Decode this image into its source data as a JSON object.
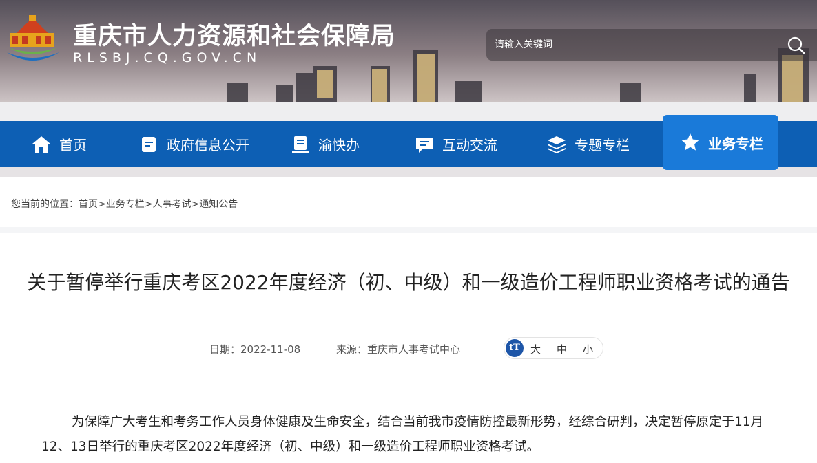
{
  "header": {
    "site_title": "重庆市人力资源和社会保障局",
    "site_domain": "RLSBJ.CQ.GOV.CN",
    "search_placeholder": "请输入关键词"
  },
  "nav": {
    "items": [
      {
        "label": "首页",
        "icon": "home-icon"
      },
      {
        "label": "政府信息公开",
        "icon": "document-icon"
      },
      {
        "label": "渝快办",
        "icon": "book-icon"
      },
      {
        "label": "互动交流",
        "icon": "chat-icon"
      },
      {
        "label": "专题专栏",
        "icon": "layers-icon"
      },
      {
        "label": "业务专栏",
        "icon": "star-icon",
        "active": true
      }
    ]
  },
  "breadcrumb": {
    "prefix": "您当前的位置：",
    "items": [
      "首页",
      "业务专栏",
      "人事考试",
      "通知公告"
    ],
    "separator": ">"
  },
  "article": {
    "title": "关于暂停举行重庆考区2022年度经济（初、中级）和一级造价工程师职业资格考试的通告",
    "date_label": "日期：",
    "date": "2022-11-08",
    "source_label": "来源：",
    "source": "重庆市人事考试中心",
    "font_size_icon": "tT",
    "font_sizes": [
      "大",
      "中",
      "小"
    ],
    "body": "为保障广大考生和考务工作人员身体健康及生命安全，结合当前我市疫情防控最新形势，经综合研判，决定暂停原定于11月12、13日举行的重庆考区2022年度经济（初、中级）和一级造价工程师职业资格考试。"
  },
  "colors": {
    "nav_bg": "#0d5fb4",
    "nav_active": "#1a7ad9"
  }
}
